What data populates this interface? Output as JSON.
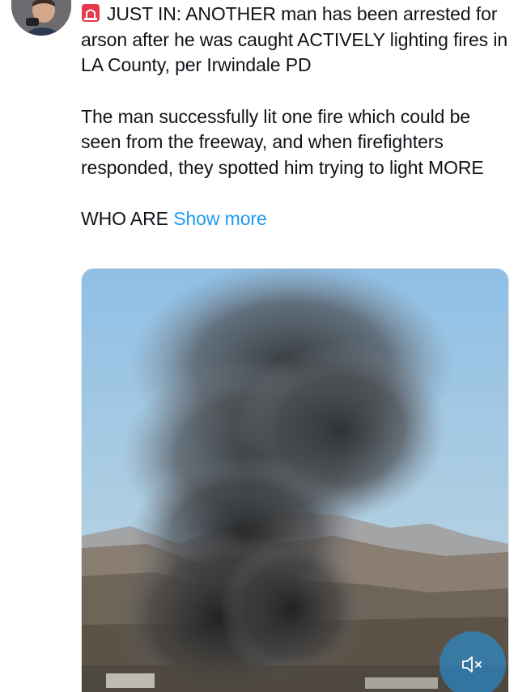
{
  "tweet": {
    "paragraphs": [
      "JUST IN: ANOTHER man has been arrested for arson after he was caught ACTIVELY lighting fires in LA County, per Irwindale PD",
      "The man successfully lit one fire which could be seen from the freeway, and when firefighters responded, they spotted him trying to light MORE"
    ],
    "teaser": "WHO ARE",
    "show_more_label": "Show more",
    "emoji": "rotating-light-icon"
  },
  "media": {
    "type": "video",
    "description_icon": "video-player",
    "muted_icon": "speaker-muted-icon"
  },
  "colors": {
    "link": "#1d9bf0",
    "text": "#0f1419",
    "smoke": "#3a3a3a",
    "sky": "#9cc4e6"
  }
}
